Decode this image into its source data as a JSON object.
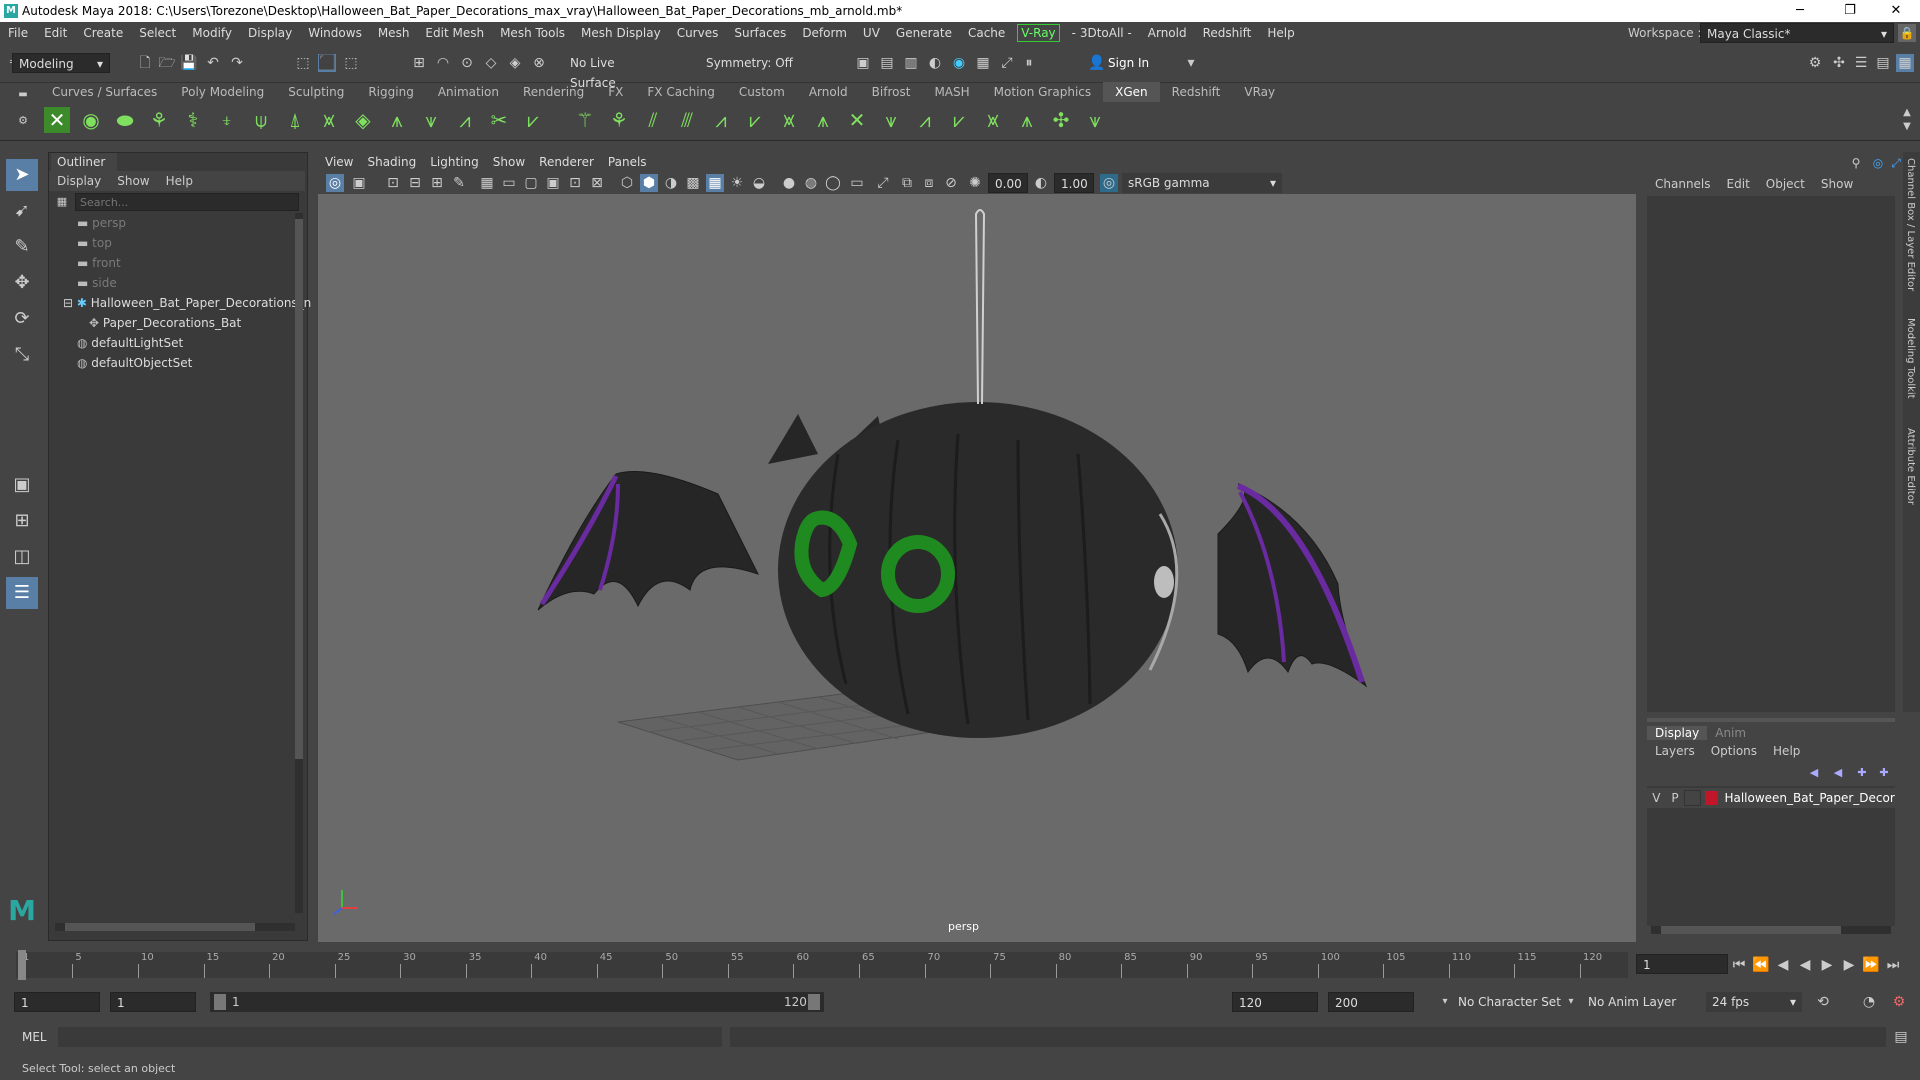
{
  "window": {
    "title": "Autodesk Maya 2018: C:\\Users\\Torezone\\Desktop\\Halloween_Bat_Paper_Decorations_max_vray\\Halloween_Bat_Paper_Decorations_mb_arnold.mb*",
    "minimize": "─",
    "restore": "❐",
    "close": "✕"
  },
  "menubar": {
    "items": [
      "File",
      "Edit",
      "Create",
      "Select",
      "Modify",
      "Display",
      "Windows",
      "Mesh",
      "Edit Mesh",
      "Mesh Tools",
      "Mesh Display",
      "Curves",
      "Surfaces",
      "Deform",
      "UV",
      "Generate",
      "Cache"
    ],
    "vray": "V-Ray",
    "items2": [
      "- 3DtoAll -",
      "Arnold",
      "Redshift",
      "Help"
    ],
    "workspace_label": "Workspace :",
    "workspace_value": "Maya Classic*"
  },
  "statusline": {
    "mode": "Modeling",
    "live_surface": "No Live Surface",
    "symmetry": "Symmetry: Off",
    "sign_in": "Sign In"
  },
  "shelf": {
    "tabs": [
      "Curves / Surfaces",
      "Poly Modeling",
      "Sculpting",
      "Rigging",
      "Animation",
      "Rendering",
      "FX",
      "FX Caching",
      "Custom",
      "Arnold",
      "Bifrost",
      "MASH",
      "Motion Graphics",
      "XGen",
      "Redshift",
      "VRay"
    ],
    "active_tab": "XGen",
    "icon_color": "#7fe060"
  },
  "outliner": {
    "title": "Outliner",
    "menu": [
      "Display",
      "Show",
      "Help"
    ],
    "search_placeholder": "Search...",
    "items": [
      {
        "label": "persp",
        "type": "camera",
        "dim": true
      },
      {
        "label": "top",
        "type": "camera",
        "dim": true
      },
      {
        "label": "front",
        "type": "camera",
        "dim": true
      },
      {
        "label": "side",
        "type": "camera",
        "dim": true
      },
      {
        "label": "Halloween_Bat_Paper_Decorations_n",
        "type": "group",
        "dim": false
      },
      {
        "label": "Paper_Decorations_Bat",
        "type": "mesh",
        "dim": false
      },
      {
        "label": "defaultLightSet",
        "type": "set",
        "dim": false
      },
      {
        "label": "defaultObjectSet",
        "type": "set",
        "dim": false
      }
    ]
  },
  "viewport": {
    "menu": [
      "View",
      "Shading",
      "Lighting",
      "Show",
      "Renderer",
      "Panels"
    ],
    "exposure": "0.00",
    "gamma": "1.00",
    "colorspace": "sRGB gamma",
    "camera_label": "persp",
    "bg_color": "#6a6a6a"
  },
  "channelbox": {
    "menu": [
      "Channels",
      "Edit",
      "Object",
      "Show"
    ],
    "side_tabs": [
      "Channel Box / Layer Editor",
      "Modeling Toolkit",
      "Attribute Editor"
    ],
    "layer_tabs": [
      "Display",
      "Anim"
    ],
    "layer_menu": [
      "Layers",
      "Options",
      "Help"
    ],
    "layer": {
      "v": "V",
      "p": "P",
      "name": "Halloween_Bat_Paper_Decorat",
      "color": "#c0162a"
    }
  },
  "timeline": {
    "ticks": [
      "1",
      "5",
      "10",
      "15",
      "20",
      "25",
      "30",
      "35",
      "40",
      "45",
      "50",
      "55",
      "60",
      "65",
      "70",
      "75",
      "80",
      "85",
      "90",
      "95",
      "100",
      "105",
      "110",
      "115",
      "120"
    ],
    "current_frame": "1"
  },
  "range": {
    "start": "1",
    "playback_start": "1",
    "slider_start": "1",
    "slider_end": "120",
    "playback_end": "120",
    "end": "200",
    "character_set": "No Character Set",
    "anim_layer": "No Anim Layer",
    "fps": "24 fps"
  },
  "cmdline": {
    "label": "MEL"
  },
  "helpline": {
    "text": "Select Tool: select an object"
  }
}
